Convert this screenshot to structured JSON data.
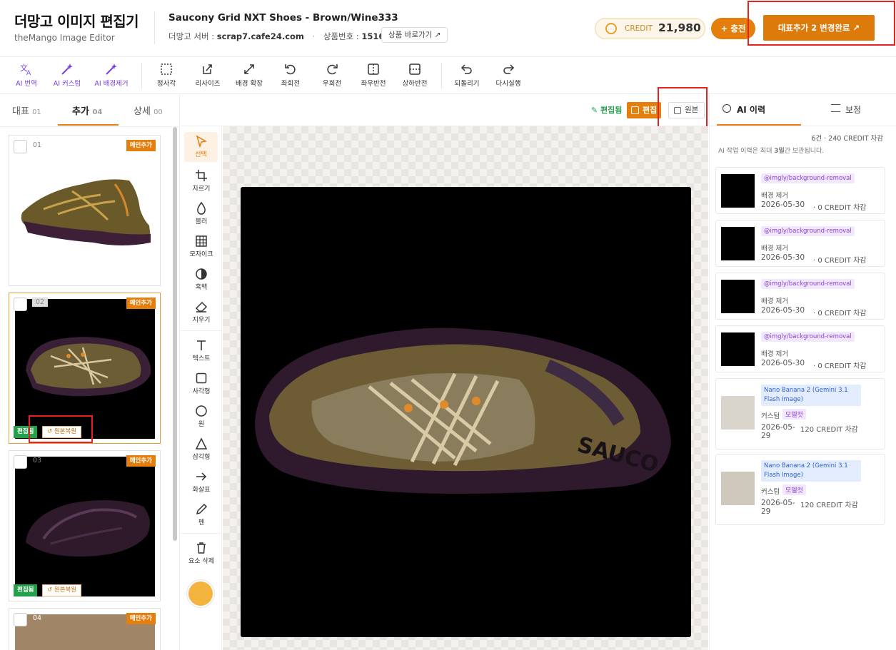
{
  "header": {
    "app_title": "더망고 이미지 편집기",
    "app_subtitle": "theMango Image Editor",
    "product_title": "Saucony Grid NXT Shoes - Brown/Wine333",
    "server_label": "더망고 서버 :",
    "server_value": "scrap7.cafe24.com",
    "product_no_label": "상품번호 :",
    "product_no_value": "151652",
    "goto_product": "상품 바로가기 ↗",
    "credit_label": "CREDIT",
    "credit_value": "21,980",
    "charge_button": "+ 충전",
    "complete_button": "대표추가 2 변경완료 ↗"
  },
  "toolbar": {
    "tools": [
      {
        "label": "AI 번역",
        "icon": "translate-icon"
      },
      {
        "label": "AI 커스텀",
        "icon": "magic-wand-icon"
      },
      {
        "label": "AI 배경제거",
        "icon": "magic-wand-icon"
      },
      {
        "label": "정사각",
        "icon": "square-dashed-icon"
      },
      {
        "label": "리사이즈",
        "icon": "resize-icon"
      },
      {
        "label": "배경 확장",
        "icon": "expand-icon"
      },
      {
        "label": "좌회전",
        "icon": "rotate-left-icon"
      },
      {
        "label": "우회전",
        "icon": "rotate-right-icon"
      },
      {
        "label": "좌우반전",
        "icon": "flip-horizontal-icon"
      },
      {
        "label": "상하반전",
        "icon": "flip-vertical-icon"
      },
      {
        "label": "되돌리기",
        "icon": "undo-icon"
      },
      {
        "label": "다시실행",
        "icon": "redo-icon"
      }
    ]
  },
  "left_panel": {
    "tabs": [
      {
        "label": "대표",
        "count": "01"
      },
      {
        "label": "추가",
        "count": "04"
      },
      {
        "label": "상세",
        "count": "00"
      }
    ],
    "cards": [
      {
        "num": "01",
        "tag": "메인추가"
      },
      {
        "num": "02",
        "tag": "메인추가",
        "edited": "편집됨",
        "restore": "↺ 원본복원"
      },
      {
        "num": "03",
        "tag": "메인추가",
        "edited": "편집됨",
        "restore": "↺ 원본복원"
      },
      {
        "num": "04",
        "tag": "메인추가"
      }
    ]
  },
  "draw_tools": [
    {
      "label": "선택",
      "icon": "cursor-icon"
    },
    {
      "label": "자르기",
      "icon": "crop-icon"
    },
    {
      "label": "블러",
      "icon": "droplet-icon"
    },
    {
      "label": "모자이크",
      "icon": "grid-icon"
    },
    {
      "label": "흑백",
      "icon": "contrast-icon"
    },
    {
      "label": "지우기",
      "icon": "eraser-icon"
    },
    {
      "label": "텍스트",
      "icon": "text-icon"
    },
    {
      "label": "사각형",
      "icon": "square-icon"
    },
    {
      "label": "원",
      "icon": "circle-icon"
    },
    {
      "label": "삼각형",
      "icon": "triangle-icon"
    },
    {
      "label": "화살표",
      "icon": "arrow-icon"
    },
    {
      "label": "펜",
      "icon": "pen-icon"
    },
    {
      "label": "요소 삭제",
      "icon": "trash-icon"
    }
  ],
  "canvas": {
    "edited_label": "✎ 편집됨",
    "edit_button": "편집",
    "original_button": "원본",
    "color": "#f4b23f"
  },
  "right_panel": {
    "tab_history": "AI 이력",
    "tab_adjust": "보정",
    "summary": "6건 · 240 CREDIT 차감",
    "note_pre": "AI 작업 이력은 최대 ",
    "note_bold": "3일",
    "note_post": "간 보관됩니다.",
    "history": [
      {
        "model": "@imgly/background-removal",
        "type": "배경 제거",
        "date": "2026-05-30",
        "cost": "· 0 CREDIT 차감"
      },
      {
        "model": "@imgly/background-removal",
        "type": "배경 제거",
        "date": "2026-05-30",
        "cost": "· 0 CREDIT 차감"
      },
      {
        "model": "@imgly/background-removal",
        "type": "배경 제거",
        "date": "2026-05-30",
        "cost": "· 0 CREDIT 차감"
      },
      {
        "model": "@imgly/background-removal",
        "type": "배경 제거",
        "date": "2026-05-30",
        "cost": "· 0 CREDIT 차감"
      },
      {
        "model": "Nano Banana 2 (Gemini 3.1 Flash Image)",
        "type": "커스텀",
        "tag": "모델컷",
        "date": "2026-05-29",
        "cost": "120 CREDIT 차감"
      },
      {
        "model": "Nano Banana 2 (Gemini 3.1 Flash Image)",
        "type": "커스텀",
        "tag": "모델컷",
        "date": "2026-05-29",
        "cost": "120 CREDIT 차감"
      }
    ]
  }
}
